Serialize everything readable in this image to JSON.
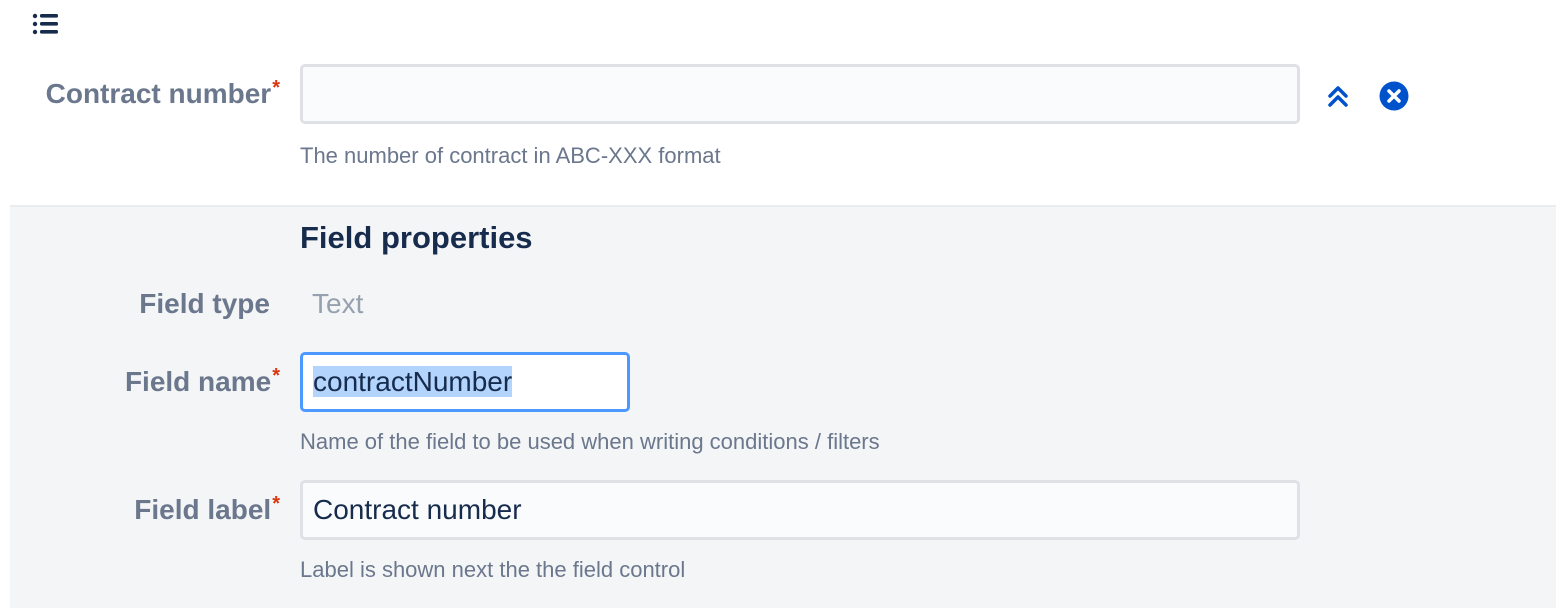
{
  "toolbar": {
    "list_icon": "list-icon"
  },
  "preview_field": {
    "label": "Contract number",
    "required_mark": "*",
    "value": "",
    "helper": "The number of contract in ABC-XXX format",
    "collapse_icon": "double-chevron-up-icon",
    "remove_icon": "close-circle-icon"
  },
  "field_properties": {
    "title": "Field properties",
    "field_type": {
      "label": "Field type",
      "value": "Text"
    },
    "field_name": {
      "label": "Field name",
      "required_mark": "*",
      "value": "contractNumber",
      "helper": "Name of the field to be used when writing conditions / filters"
    },
    "field_label": {
      "label": "Field label",
      "required_mark": "*",
      "value": "Contract number",
      "helper": "Label is shown next the the field control"
    }
  },
  "colors": {
    "accent": "#0052cc",
    "required": "#de350b",
    "focus_border": "#4c9aff",
    "panel_bg": "#f4f5f7"
  }
}
